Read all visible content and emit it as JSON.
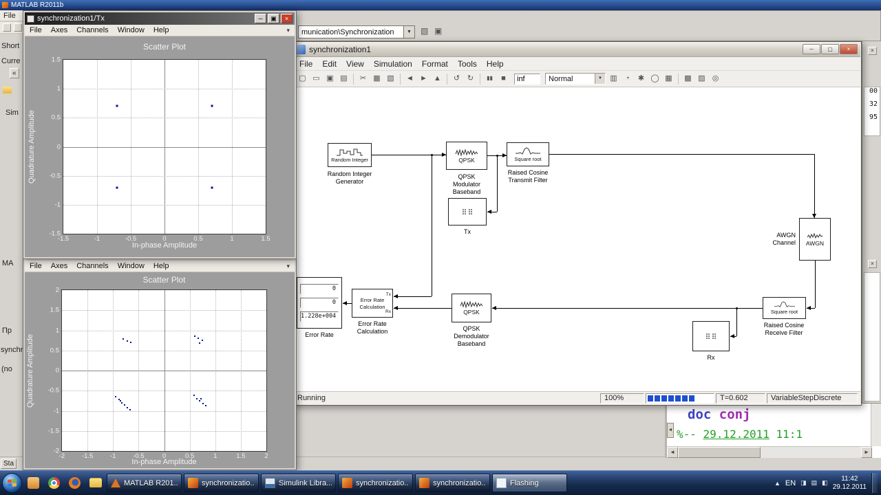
{
  "matlab": {
    "window_title": "MATLAB R2011b",
    "menu_file": "File",
    "fragments": {
      "shortcuts": "Short",
      "current_folder": "Curre",
      "collapse": "«",
      "sim_tree": "Sim",
      "ma": "MA",
      "pr": "Пр",
      "synchr": "synchr",
      "no_details": "(no",
      "start_button": "Sta"
    },
    "command_window": {
      "cmd_word1": "doc",
      "cmd_word2": "conj",
      "stamp_prefix": "%-- ",
      "stamp_date": "29.12.2011",
      "stamp_time": " 11:1"
    },
    "right_edge_numbers": [
      "00",
      "32",
      "95"
    ]
  },
  "library_browser": {
    "address": "munication\\Synchronization"
  },
  "simulink": {
    "window_title": "synchronization1",
    "menus": [
      "File",
      "Edit",
      "View",
      "Simulation",
      "Format",
      "Tools",
      "Help"
    ],
    "toolbar": {
      "sim_stop_time": "inf",
      "sim_mode": "Normal"
    },
    "status": {
      "state": "Running",
      "zoom": "100%",
      "sim_time": "T=0.602",
      "solver": "VariableStepDiscrete"
    },
    "blocks": {
      "random_integer": {
        "inner": "Random Integer",
        "label": [
          "Random Integer",
          "Generator"
        ]
      },
      "qpsk_mod": {
        "inner": "QPSK",
        "label": [
          "QPSK",
          "Modulator",
          "Baseband"
        ]
      },
      "srrc_tx": {
        "inner": "Square root",
        "label": [
          "Raised Cosine",
          "Transmit Filter"
        ]
      },
      "tx_scope": {
        "label": "Tx"
      },
      "awgn": {
        "inner": "AWGN",
        "label": [
          "AWGN",
          "Channel"
        ]
      },
      "srrc_rx": {
        "inner": "Square root",
        "label": [
          "Raised Cosine",
          "Receive Filter"
        ]
      },
      "rx_scope": {
        "label": "Rx"
      },
      "qpsk_demod": {
        "inner": "QPSK",
        "label": [
          "QPSK",
          "Demodulator",
          "Baseband"
        ]
      },
      "error_rate": {
        "inner": [
          "Error Rate",
          "Calculation"
        ],
        "ports": [
          "Tx",
          "Rx"
        ],
        "label": [
          "Error Rate",
          "Calculation"
        ]
      },
      "display": {
        "values": [
          "0",
          "0",
          "1.228e+004"
        ],
        "label": "Error Rate"
      }
    }
  },
  "scope_menus": [
    "File",
    "Axes",
    "Channels",
    "Window",
    "Help"
  ],
  "scatter_tx": {
    "window_title": "synchronization1/Tx",
    "plot_title": "Scatter Plot",
    "xlabel": "In-phase Amplitude",
    "ylabel": "Quadrature Amplitude",
    "chart": {
      "type": "scatter",
      "xlim": [
        -1.5,
        1.5
      ],
      "ylim": [
        -1.5,
        1.5
      ],
      "xticks": [
        -1.5,
        -1,
        -0.5,
        0,
        0.5,
        1,
        1.5
      ],
      "yticks": [
        -1.5,
        -1,
        -0.5,
        0,
        0.5,
        1,
        1.5
      ],
      "points": [
        [
          -0.7,
          0.7
        ],
        [
          0.7,
          0.7
        ],
        [
          -0.7,
          -0.7
        ],
        [
          0.7,
          -0.7
        ]
      ]
    }
  },
  "scatter_rx": {
    "plot_title": "Scatter Plot",
    "xlabel": "In-phase Amplitude",
    "ylabel": "Quadrature Amplitude",
    "chart": {
      "type": "scatter",
      "xlim": [
        -2,
        2
      ],
      "ylim": [
        -2,
        2
      ],
      "xticks": [
        -2,
        -1.5,
        -1,
        -0.5,
        0,
        0.5,
        1,
        1.5,
        2
      ],
      "yticks": [
        -2,
        -1.5,
        -1,
        -0.5,
        0,
        0.5,
        1,
        1.5,
        2
      ],
      "points": [
        [
          -0.8,
          0.78
        ],
        [
          -0.72,
          0.74
        ],
        [
          -0.65,
          0.7
        ],
        [
          0.6,
          0.86
        ],
        [
          0.67,
          0.8
        ],
        [
          0.75,
          0.76
        ],
        [
          0.7,
          0.68
        ],
        [
          -0.95,
          -0.65
        ],
        [
          -0.88,
          -0.72
        ],
        [
          -0.83,
          -0.8
        ],
        [
          -0.78,
          -0.86
        ],
        [
          -0.72,
          -0.92
        ],
        [
          -0.67,
          -0.97
        ],
        [
          -0.85,
          -0.75
        ],
        [
          0.58,
          -0.62
        ],
        [
          0.64,
          -0.7
        ],
        [
          0.7,
          -0.76
        ],
        [
          0.76,
          -0.82
        ],
        [
          0.82,
          -0.88
        ],
        [
          0.72,
          -0.7
        ]
      ]
    }
  },
  "taskbar": {
    "language": "EN",
    "time": "11:42",
    "date": "29.12.2011",
    "buttons": [
      "MATLAB R201...",
      "synchronizatio...",
      "Simulink Libra...",
      "synchronizatio...",
      "synchronizatio...",
      "Flashing"
    ]
  },
  "icons": {
    "dropdown": "▼",
    "chevron": "▾",
    "minimize": "─",
    "maximize": "▢",
    "restore": "▣",
    "close": "×",
    "back": "◄",
    "forward": "►",
    "up": "▲",
    "new": "▢",
    "open": "▭",
    "save": "▣",
    "print": "▤",
    "cut": "✂",
    "copy": "▦",
    "paste": "▧",
    "undo": "↺",
    "redo": "↻",
    "pause": "▮▮",
    "stop": "■",
    "library": "▥",
    "clock": "◔",
    "gear": "✱",
    "globe": "◯",
    "grid": "▦",
    "report": "▩",
    "camera": "▨",
    "target": "◎",
    "splitter_left": "◄",
    "tray1": "◨",
    "tray2": "▤",
    "tray3": "◧"
  }
}
